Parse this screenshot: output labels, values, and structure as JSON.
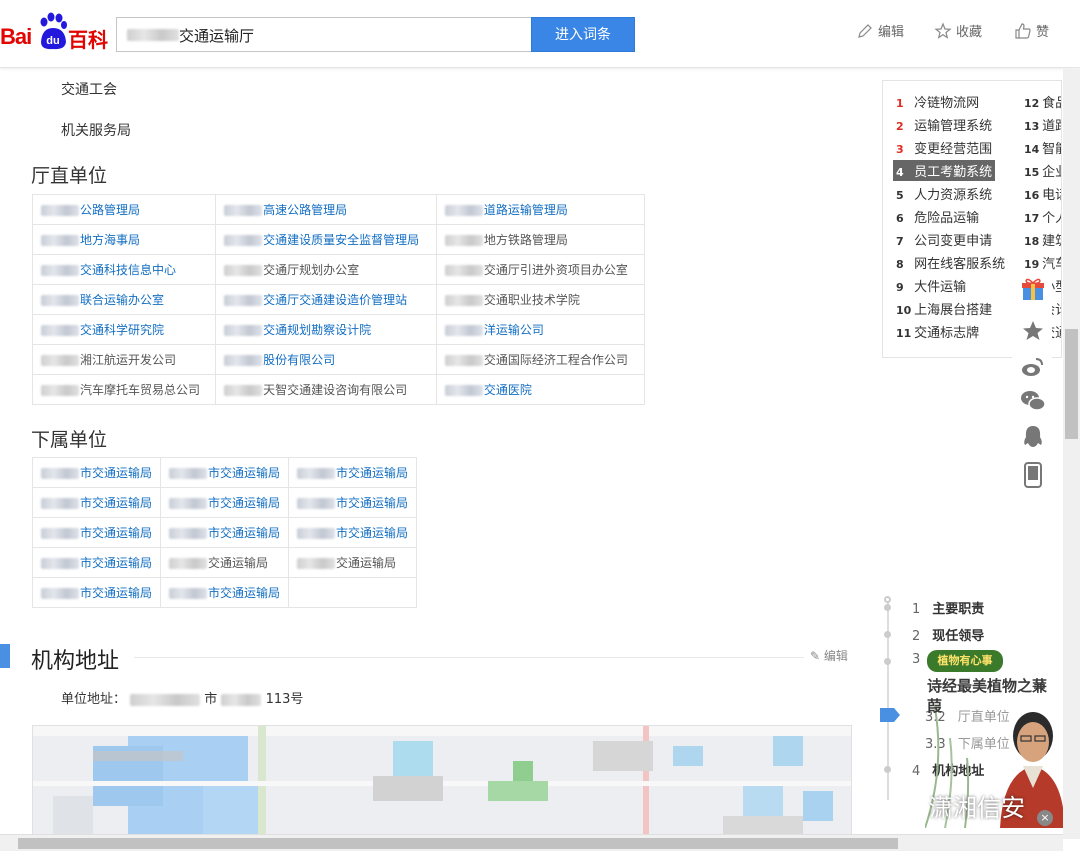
{
  "header": {
    "logo_bai": "Bai",
    "logo_du": "du",
    "logo_baike": "百科",
    "search_value": "交通运输厅",
    "enter_button": "进入词条",
    "edit": "编辑",
    "favorite": "收藏",
    "like": "赞"
  },
  "main": {
    "top_items": [
      "交通工会",
      "机关服务局"
    ],
    "direct_title": "厅直单位",
    "direct_units": [
      [
        "公路管理局",
        "高速公路管理局",
        "道路运输管理局"
      ],
      [
        "地方海事局",
        "交通建设质量安全监督管理局",
        "地方铁路管理局"
      ],
      [
        "交通科技信息中心",
        "交通厅规划办公室",
        "交通厅引进外资项目办公室"
      ],
      [
        "联合运输办公室",
        "交通厅交通建设造价管理站",
        "交通职业技术学院"
      ],
      [
        "交通科学研究院",
        "交通规划勘察设计院",
        "洋运输公司"
      ],
      [
        "湘江航运开发公司",
        "股份有限公司",
        "交通国际经济工程合作公司"
      ],
      [
        "汽车摩托车贸易总公司",
        "天智交通建设咨询有限公司",
        "交通医院"
      ]
    ],
    "sub_title": "下属单位",
    "sub_units": [
      [
        "市交通运输局",
        "市交通运输局",
        "市交通运输局"
      ],
      [
        "市交通运输局",
        "市交通运输局",
        "市交通运输局"
      ],
      [
        "市交通运输局",
        "市交通运输局",
        "市交通运输局"
      ],
      [
        "市交通运输局",
        "交通运输局",
        "交通运输局"
      ],
      [
        "市交通运输局",
        "市交通运输局",
        ""
      ]
    ],
    "address_title": "机构地址",
    "address_edit": "编辑",
    "address_label": "单位地址：",
    "address_mid": "市",
    "address_tail": "113号"
  },
  "related": {
    "left": [
      {
        "n": "1",
        "label": "冷链物流网",
        "red": true
      },
      {
        "n": "2",
        "label": "运输管理系统",
        "red": true
      },
      {
        "n": "3",
        "label": "变更经营范围",
        "red": true
      },
      {
        "n": "4",
        "label": "员工考勤系统",
        "selected": true
      },
      {
        "n": "5",
        "label": "人力资源系统"
      },
      {
        "n": "6",
        "label": "危险品运输"
      },
      {
        "n": "7",
        "label": "公司变更申请"
      },
      {
        "n": "8",
        "label": "网在线客服系统"
      },
      {
        "n": "9",
        "label": "大件运输"
      },
      {
        "n": "10",
        "label": "上海展台搭建"
      },
      {
        "n": "11",
        "label": "交通标志牌"
      }
    ],
    "right": [
      {
        "n": "12",
        "label": "食品"
      },
      {
        "n": "13",
        "label": "道路"
      },
      {
        "n": "14",
        "label": "智能"
      },
      {
        "n": "15",
        "label": "企业"
      },
      {
        "n": "16",
        "label": "电话"
      },
      {
        "n": "17",
        "label": "个人"
      },
      {
        "n": "18",
        "label": "建筑"
      },
      {
        "n": "19",
        "label": "汽车"
      },
      {
        "n": "20",
        "label": "小型"
      },
      {
        "n": "21",
        "label": "会计"
      },
      {
        "n": "22",
        "label": "交通"
      }
    ]
  },
  "toc": {
    "items": [
      {
        "n": "1",
        "label": "主要职责"
      },
      {
        "n": "2",
        "label": "现任领导"
      },
      {
        "n": "3",
        "label": ""
      },
      {
        "n": "3.2",
        "label": "厅直单位",
        "sub": true
      },
      {
        "n": "3.3",
        "label": "下属单位",
        "sub": true
      },
      {
        "n": "4",
        "label": "机构地址"
      }
    ]
  },
  "overlay": {
    "badge": "植物有心事",
    "title": "诗经最美植物之蒹葭",
    "watermark": "潇湘信安"
  }
}
